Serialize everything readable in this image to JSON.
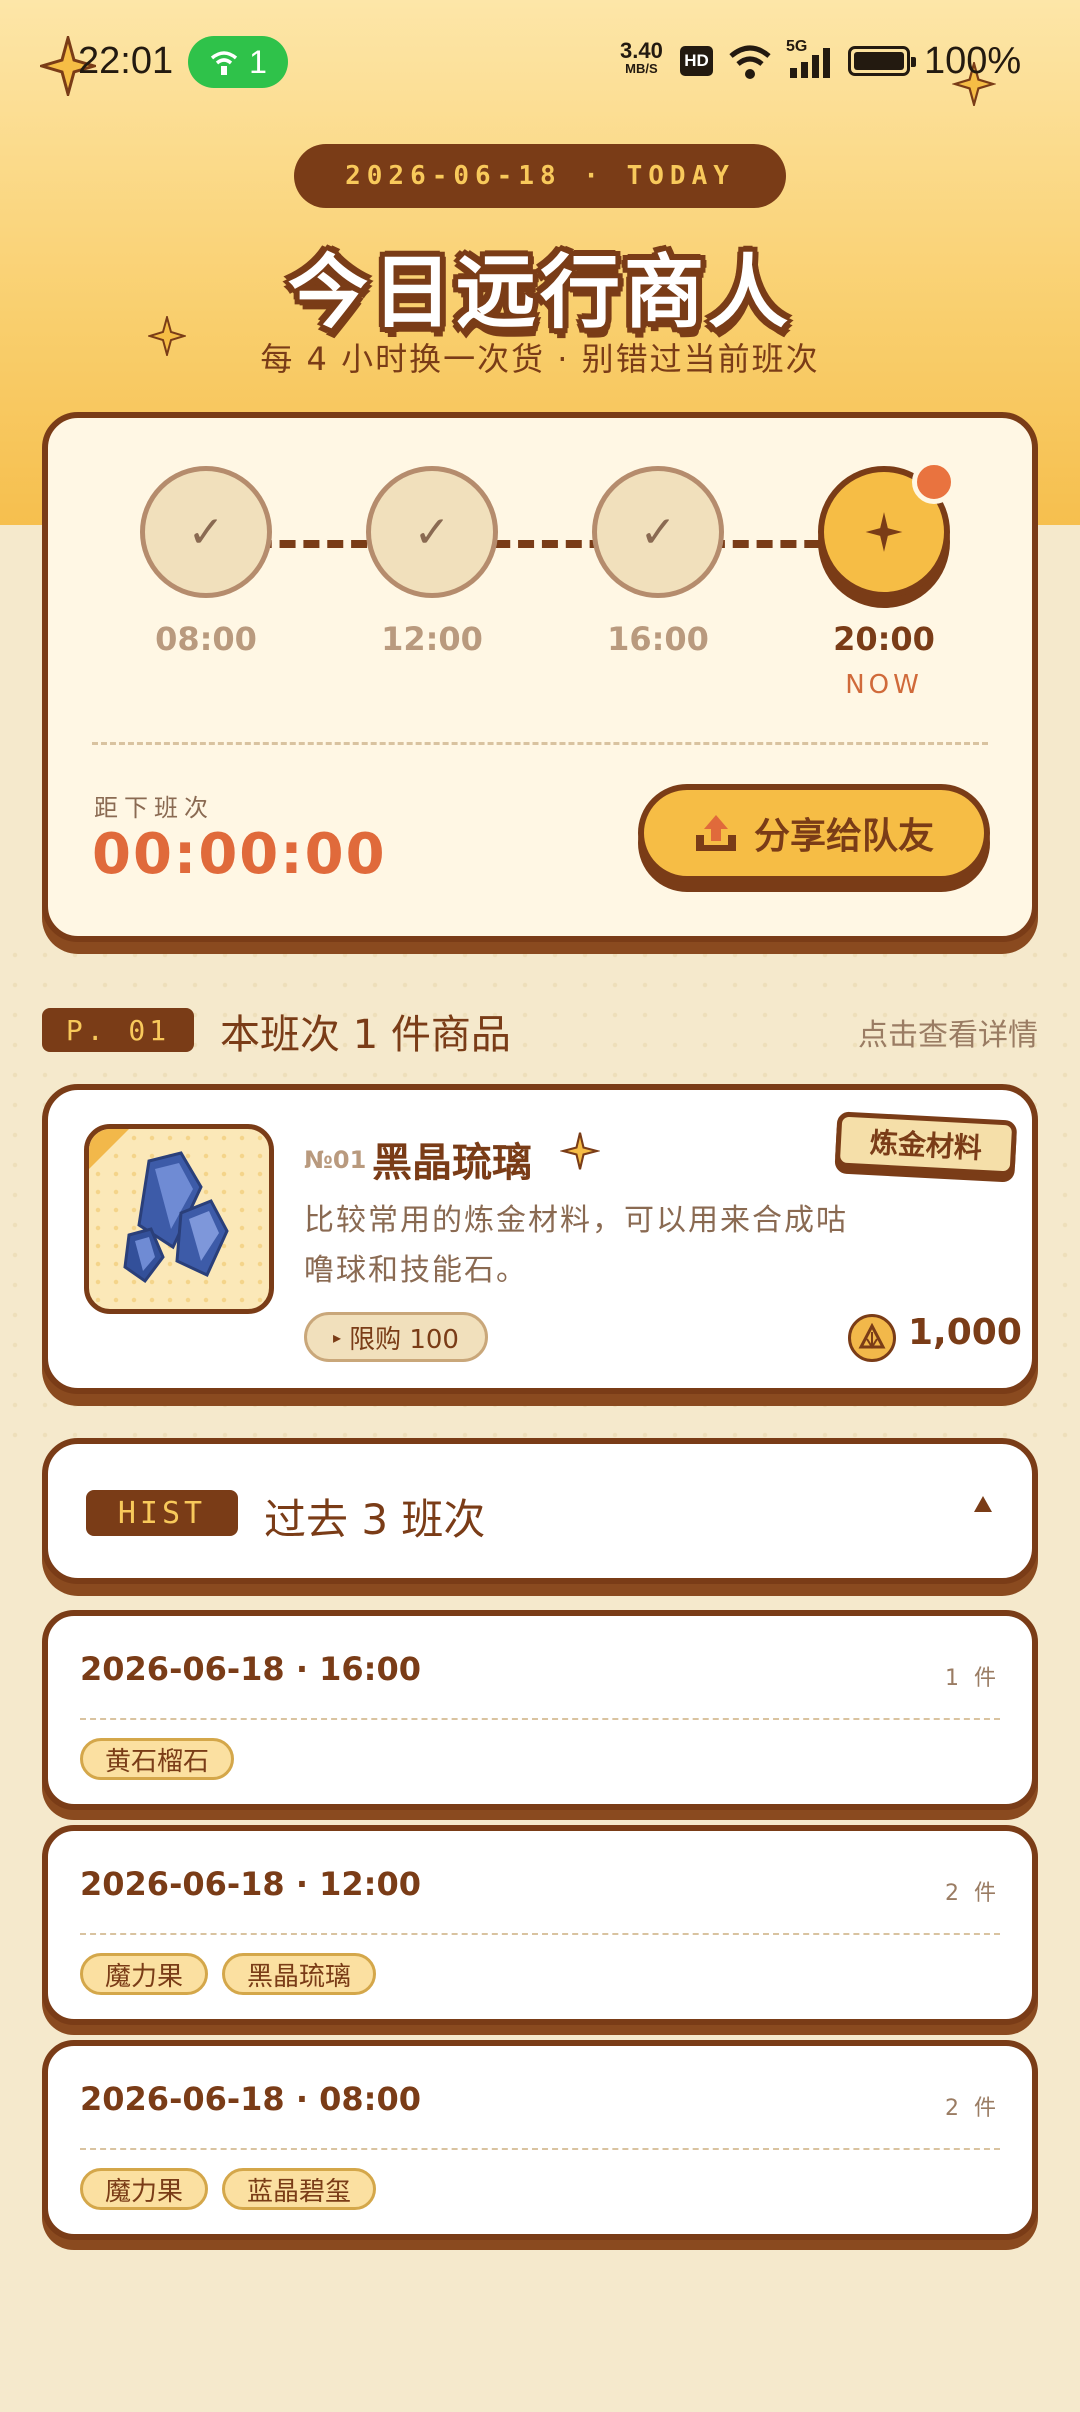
{
  "status_bar": {
    "time": "22:01",
    "hotspot_count": "1",
    "net_speed_value": "3.40",
    "net_speed_unit": "MB/S",
    "hd_label": "HD",
    "signal_label": "5G",
    "battery_pct": "100%"
  },
  "header": {
    "date_pill": "2026-06-18 · TODAY",
    "title": "今日远行商人",
    "subtitle": "每 4 小时换一次货 · 别错过当前班次"
  },
  "schedule": {
    "slots": [
      {
        "time": "08:00",
        "state": "done"
      },
      {
        "time": "12:00",
        "state": "done"
      },
      {
        "time": "16:00",
        "state": "done"
      },
      {
        "time": "20:00",
        "state": "current"
      }
    ],
    "now_label": "NOW",
    "countdown_label": "距下班次",
    "countdown": "00:00:00",
    "share_label": "分享给队友"
  },
  "current": {
    "badge": "P. 01",
    "title": "本班次 1 件商品",
    "detail_link": "点击查看详情",
    "item": {
      "no": "№01",
      "name": "黑晶琉璃",
      "category": "炼金材料",
      "desc": "比较常用的炼金材料，可以用来合成咕噜球和技能石。",
      "limit": "限购 100",
      "price": "1,000"
    }
  },
  "history": {
    "badge": "HIST",
    "title": "过去 3 班次",
    "rows": [
      {
        "date": "2026-06-18 · 16:00",
        "count": "1 件",
        "items": [
          "黄石榴石"
        ]
      },
      {
        "date": "2026-06-18 · 12:00",
        "count": "2 件",
        "items": [
          "魔力果",
          "黑晶琉璃"
        ]
      },
      {
        "date": "2026-06-18 · 08:00",
        "count": "2 件",
        "items": [
          "魔力果",
          "蓝晶碧玺"
        ]
      }
    ]
  },
  "colors": {
    "brown": "#7a3c17",
    "gold": "#f6bd45",
    "accent_red": "#e06a3b",
    "cream": "#fff7e4"
  }
}
